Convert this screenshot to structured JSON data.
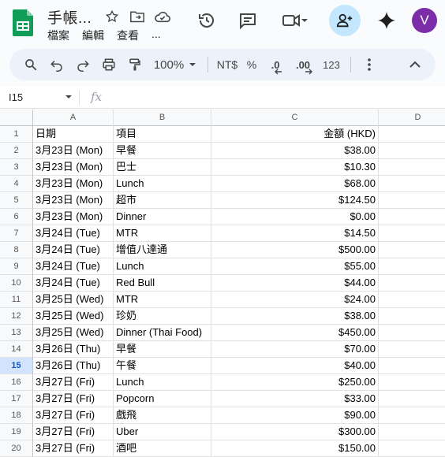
{
  "header": {
    "doc_title": "手帳...",
    "menus": [
      "檔案",
      "編輯",
      "查看",
      "..."
    ],
    "avatar_letter": "V"
  },
  "toolbar": {
    "zoom": "100%",
    "currency": "NT$",
    "percent": "%",
    "dec_decrease": ".0",
    "dec_increase": ".00",
    "number_format": "123"
  },
  "formula_bar": {
    "cell_ref": "I15",
    "fx": "fx",
    "value": ""
  },
  "sheet": {
    "columns": [
      "A",
      "B",
      "C",
      "D"
    ],
    "selected_row": 15,
    "rows": [
      {
        "n": "1",
        "a": "日期",
        "b": "項目",
        "c": "金額 (HKD)"
      },
      {
        "n": "2",
        "a": "3月23日 (Mon)",
        "b": "早餐",
        "c": "$38.00"
      },
      {
        "n": "3",
        "a": "3月23日 (Mon)",
        "b": "巴士",
        "c": "$10.30"
      },
      {
        "n": "4",
        "a": "3月23日 (Mon)",
        "b": "Lunch",
        "c": "$68.00"
      },
      {
        "n": "5",
        "a": "3月23日 (Mon)",
        "b": "超市",
        "c": "$124.50"
      },
      {
        "n": "6",
        "a": "3月23日 (Mon)",
        "b": "Dinner",
        "c": "$0.00"
      },
      {
        "n": "7",
        "a": "3月24日 (Tue)",
        "b": "MTR",
        "c": "$14.50"
      },
      {
        "n": "8",
        "a": "3月24日 (Tue)",
        "b": "增值八達通",
        "c": "$500.00"
      },
      {
        "n": "9",
        "a": "3月24日 (Tue)",
        "b": "Lunch",
        "c": "$55.00"
      },
      {
        "n": "10",
        "a": "3月24日 (Tue)",
        "b": "Red Bull",
        "c": "$44.00"
      },
      {
        "n": "11",
        "a": "3月25日 (Wed)",
        "b": "MTR",
        "c": "$24.00"
      },
      {
        "n": "12",
        "a": "3月25日 (Wed)",
        "b": "珍奶",
        "c": "$38.00"
      },
      {
        "n": "13",
        "a": "3月25日 (Wed)",
        "b": "Dinner (Thai Food)",
        "c": "$450.00"
      },
      {
        "n": "14",
        "a": "3月26日 (Thu)",
        "b": "早餐",
        "c": "$70.00"
      },
      {
        "n": "15",
        "a": "3月26日 (Thu)",
        "b": "午餐",
        "c": "$40.00"
      },
      {
        "n": "16",
        "a": "3月27日 (Fri)",
        "b": "Lunch",
        "c": "$250.00"
      },
      {
        "n": "17",
        "a": "3月27日 (Fri)",
        "b": "Popcorn",
        "c": "$33.00"
      },
      {
        "n": "18",
        "a": "3月27日 (Fri)",
        "b": "戲飛",
        "c": "$90.00"
      },
      {
        "n": "19",
        "a": "3月27日 (Fri)",
        "b": "Uber",
        "c": "$300.00"
      },
      {
        "n": "20",
        "a": "3月27日 (Fri)",
        "b": "酒吧",
        "c": "$150.00"
      }
    ]
  },
  "colors": {
    "accent": "#0b57d0",
    "share_bg": "#c2e7ff",
    "avatar_bg": "#7b2ea8",
    "sheets_green": "#188038"
  }
}
